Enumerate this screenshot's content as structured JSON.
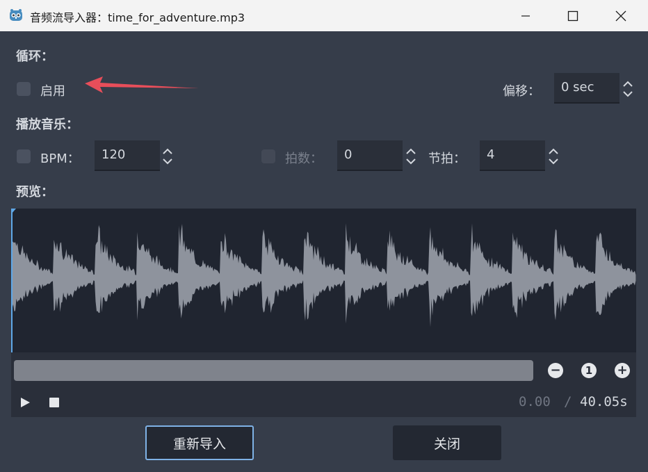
{
  "window": {
    "title": "音频流导入器：time_for_adventure.mp3"
  },
  "loop": {
    "heading": "循环：",
    "enable_label": "启用",
    "enable_checked": false,
    "offset_label": "偏移：",
    "offset_value": "0 sec"
  },
  "music": {
    "heading": "播放音乐：",
    "bpm_label": "BPM：",
    "bpm_checked": false,
    "bpm_value": "120",
    "beats_label": "拍数：",
    "beats_checked": false,
    "beats_value": "0",
    "bar_beats_label": "节拍：",
    "bar_beats_value": "4"
  },
  "preview": {
    "heading": "预览：",
    "current_time": "0.00",
    "separator": "/",
    "total_time": "40.05s"
  },
  "buttons": {
    "reimport": "重新导入",
    "close": "关闭"
  },
  "colors": {
    "accent": "#5fa8e8",
    "arrow": "#e84e5a",
    "waveform": "#8e939d"
  }
}
